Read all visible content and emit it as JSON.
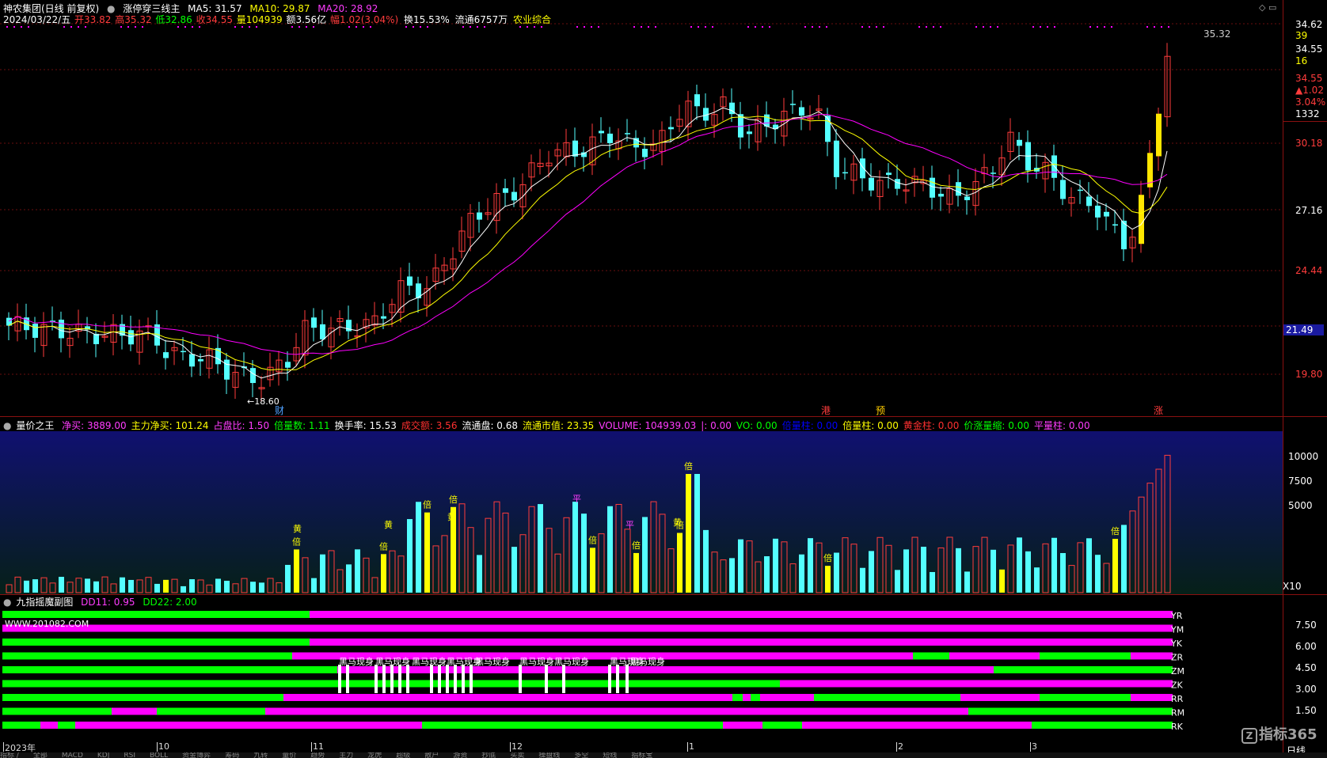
{
  "header": {
    "stock_name": "神农集团(日线 前复权)",
    "indicator_main": "涨停穿三线主",
    "ma5": "MA5: 31.57",
    "ma10": "MA10: 29.87",
    "ma20": "MA20: 28.92",
    "line2": {
      "date": "2024/03/22/五",
      "open": "开33.82",
      "high": "高35.32",
      "low": "低32.86",
      "close": "收34.55",
      "volume": "量104939",
      "amount": "额3.56亿",
      "change": "幅1.02(3.04%)",
      "turnover": "换15.53%",
      "float": "流通6757万",
      "sector": "农业综合"
    }
  },
  "price_axis": {
    "labels": [
      "34.62",
      "39",
      "34.55",
      "16",
      "34.55",
      "▲1.02",
      "3.04%",
      "1332",
      "30.18",
      "27.16",
      "24.44",
      "21.49",
      "19.80"
    ],
    "high_marker": "35.32",
    "low_marker": "18.60",
    "current_tag": "21.49"
  },
  "event_marks": {
    "cai": "财",
    "gang": "港",
    "yu": "预",
    "zhang": "涨"
  },
  "vol_panel": {
    "title": "量价之王",
    "items": [
      {
        "text": "净买: 3889.00",
        "color": "#ff3cff"
      },
      {
        "text": "主力净买: 101.24",
        "color": "#ffff00"
      },
      {
        "text": "占盘比: 1.50",
        "color": "#ff3cff"
      },
      {
        "text": "倍量数: 1.11",
        "color": "#00ff00"
      },
      {
        "text": "换手率: 15.53",
        "color": "#ffffff"
      },
      {
        "text": "成交额: 3.56",
        "color": "#ff3030"
      },
      {
        "text": "流通盘: 0.68",
        "color": "#ffffff"
      },
      {
        "text": "流通市值: 23.35",
        "color": "#ffff00"
      },
      {
        "text": "VOLUME: 104939.03",
        "color": "#ff3cff"
      },
      {
        "text": "|: 0.00",
        "color": "#ff3cff"
      },
      {
        "text": "VO: 0.00",
        "color": "#00ff00"
      },
      {
        "text": "倍量柱: 0.00",
        "color": "#0000ff"
      },
      {
        "text": "倍量柱: 0.00",
        "color": "#ffff00"
      },
      {
        "text": "黄金柱: 0.00",
        "color": "#ff3030"
      },
      {
        "text": "价涨量缩: 0.00",
        "color": "#00ff00"
      },
      {
        "text": "平量柱: 0.00",
        "color": "#ff3cff"
      }
    ],
    "axis": [
      "10000",
      "7500",
      "5000"
    ],
    "unit": "X10",
    "bei": "倍",
    "huang": "黄",
    "ping": "平"
  },
  "nine_panel": {
    "title": "九指摇魔副图",
    "dd11": "DD11: 0.95",
    "dd22": "DD22: 2.00",
    "watermark": "WWW.201082.COM",
    "rows": [
      "YR",
      "YM",
      "YK",
      "ZR",
      "ZM",
      "ZK",
      "RR",
      "RM",
      "RK"
    ],
    "axis": [
      "7.50",
      "6.00",
      "4.50",
      "3.00",
      "1.50"
    ],
    "horse_text": "黑马现身"
  },
  "time_axis": {
    "labels": [
      "2023年",
      "10",
      "11",
      "12",
      "1",
      "2",
      "3"
    ],
    "period": "日线"
  },
  "bottom_tabs": [
    "指标 /",
    "全部",
    "MACD",
    "KDJ",
    "RSI",
    "BOLL",
    "资金博弈",
    "筹码",
    "九转",
    "量价",
    "趋势",
    "主力",
    "龙虎",
    "超级",
    "散户",
    "游资",
    "抄底",
    "买卖",
    "操盘线",
    "多空",
    "短线",
    "指标宝"
  ],
  "logo": "指标365",
  "colors": {
    "up": "#ff3c3c",
    "down": "#54ffff",
    "ma5": "#ffffff",
    "ma10": "#ffff00",
    "ma20": "#ff00ff",
    "frame": "#8a1010"
  }
}
